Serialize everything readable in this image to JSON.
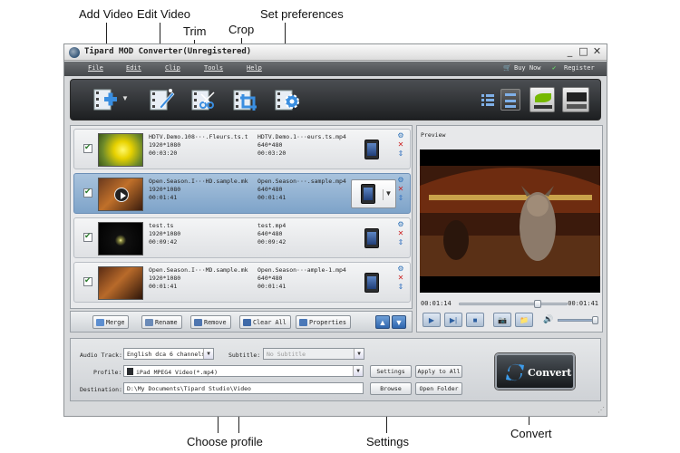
{
  "callouts": {
    "add_video": "Add Video",
    "edit_video": "Edit Video",
    "trim": "Trim",
    "crop": "Crop",
    "set_preferences": "Set preferences",
    "choose_profile": "Choose profile",
    "settings": "Settings",
    "convert": "Convert"
  },
  "window": {
    "title": "Tipard MOD Converter(Unregistered)",
    "controls": [
      "_",
      "□",
      "✕"
    ]
  },
  "menu": {
    "items": [
      "File",
      "Edit",
      "Clip",
      "Tools",
      "Help"
    ],
    "buy_now": "Buy Now",
    "register": "Register"
  },
  "toolbar": {
    "icons": [
      "add-video-icon",
      "edit-video-icon",
      "trim-icon",
      "crop-icon",
      "preferences-icon"
    ],
    "right_icons": [
      "list-view-icon",
      "detail-view-icon",
      "nvidia-icon",
      "amd-icon"
    ]
  },
  "files": [
    {
      "source_name": "HDTV.Demo.108···.Fleurs.ts.ts",
      "source_res": "1920*1080",
      "source_dur": "00:03:20",
      "output_name": "HDTV.Demo.1···eurs.ts.mp4",
      "output_res": "640*480",
      "output_dur": "00:03:20",
      "selected": false
    },
    {
      "source_name": "Open.Season.I···HD.sample.mkv",
      "source_res": "1920*1080",
      "source_dur": "00:01:41",
      "output_name": "Open.Season···.sample.mp4",
      "output_res": "640*480",
      "output_dur": "00:01:41",
      "selected": true
    },
    {
      "source_name": "test.ts",
      "source_res": "1920*1080",
      "source_dur": "00:09:42",
      "output_name": "test.mp4",
      "output_res": "640*480",
      "output_dur": "00:09:42",
      "selected": false
    },
    {
      "source_name": "Open.Season.I···MD.sample.mkv",
      "source_res": "1920*1080",
      "source_dur": "00:01:41",
      "output_name": "Open.Season···ample-1.mp4",
      "output_res": "640*480",
      "output_dur": "00:01:41",
      "selected": false
    }
  ],
  "list_buttons": {
    "merge": "Merge",
    "rename": "Rename",
    "remove": "Remove",
    "clear_all": "Clear All",
    "properties": "Properties"
  },
  "preview": {
    "title": "Preview",
    "time_current": "00:01:14",
    "time_total": "00:01:41",
    "progress": 0.73,
    "volume": 0.95
  },
  "settings_panel": {
    "audio_track_label": "Audio Track:",
    "audio_track_value": "English dca 6 channels (0",
    "subtitle_label": "Subtitle:",
    "subtitle_value": "No Subtitle",
    "profile_label": "Profile:",
    "profile_value": "iPad MPEG4 Video(*.mp4)",
    "destination_label": "Destination:",
    "destination_value": "D:\\My Documents\\Tipard Studio\\Video",
    "settings_button": "Settings",
    "apply_to_all_button": "Apply to All",
    "browse_button": "Browse",
    "open_folder_button": "Open Folder",
    "convert_button": "Convert"
  },
  "colors": {
    "accent_blue": "#2e65ad",
    "toolbar_dark": "#1d1f21",
    "selected_row": "#7ea3c9"
  }
}
